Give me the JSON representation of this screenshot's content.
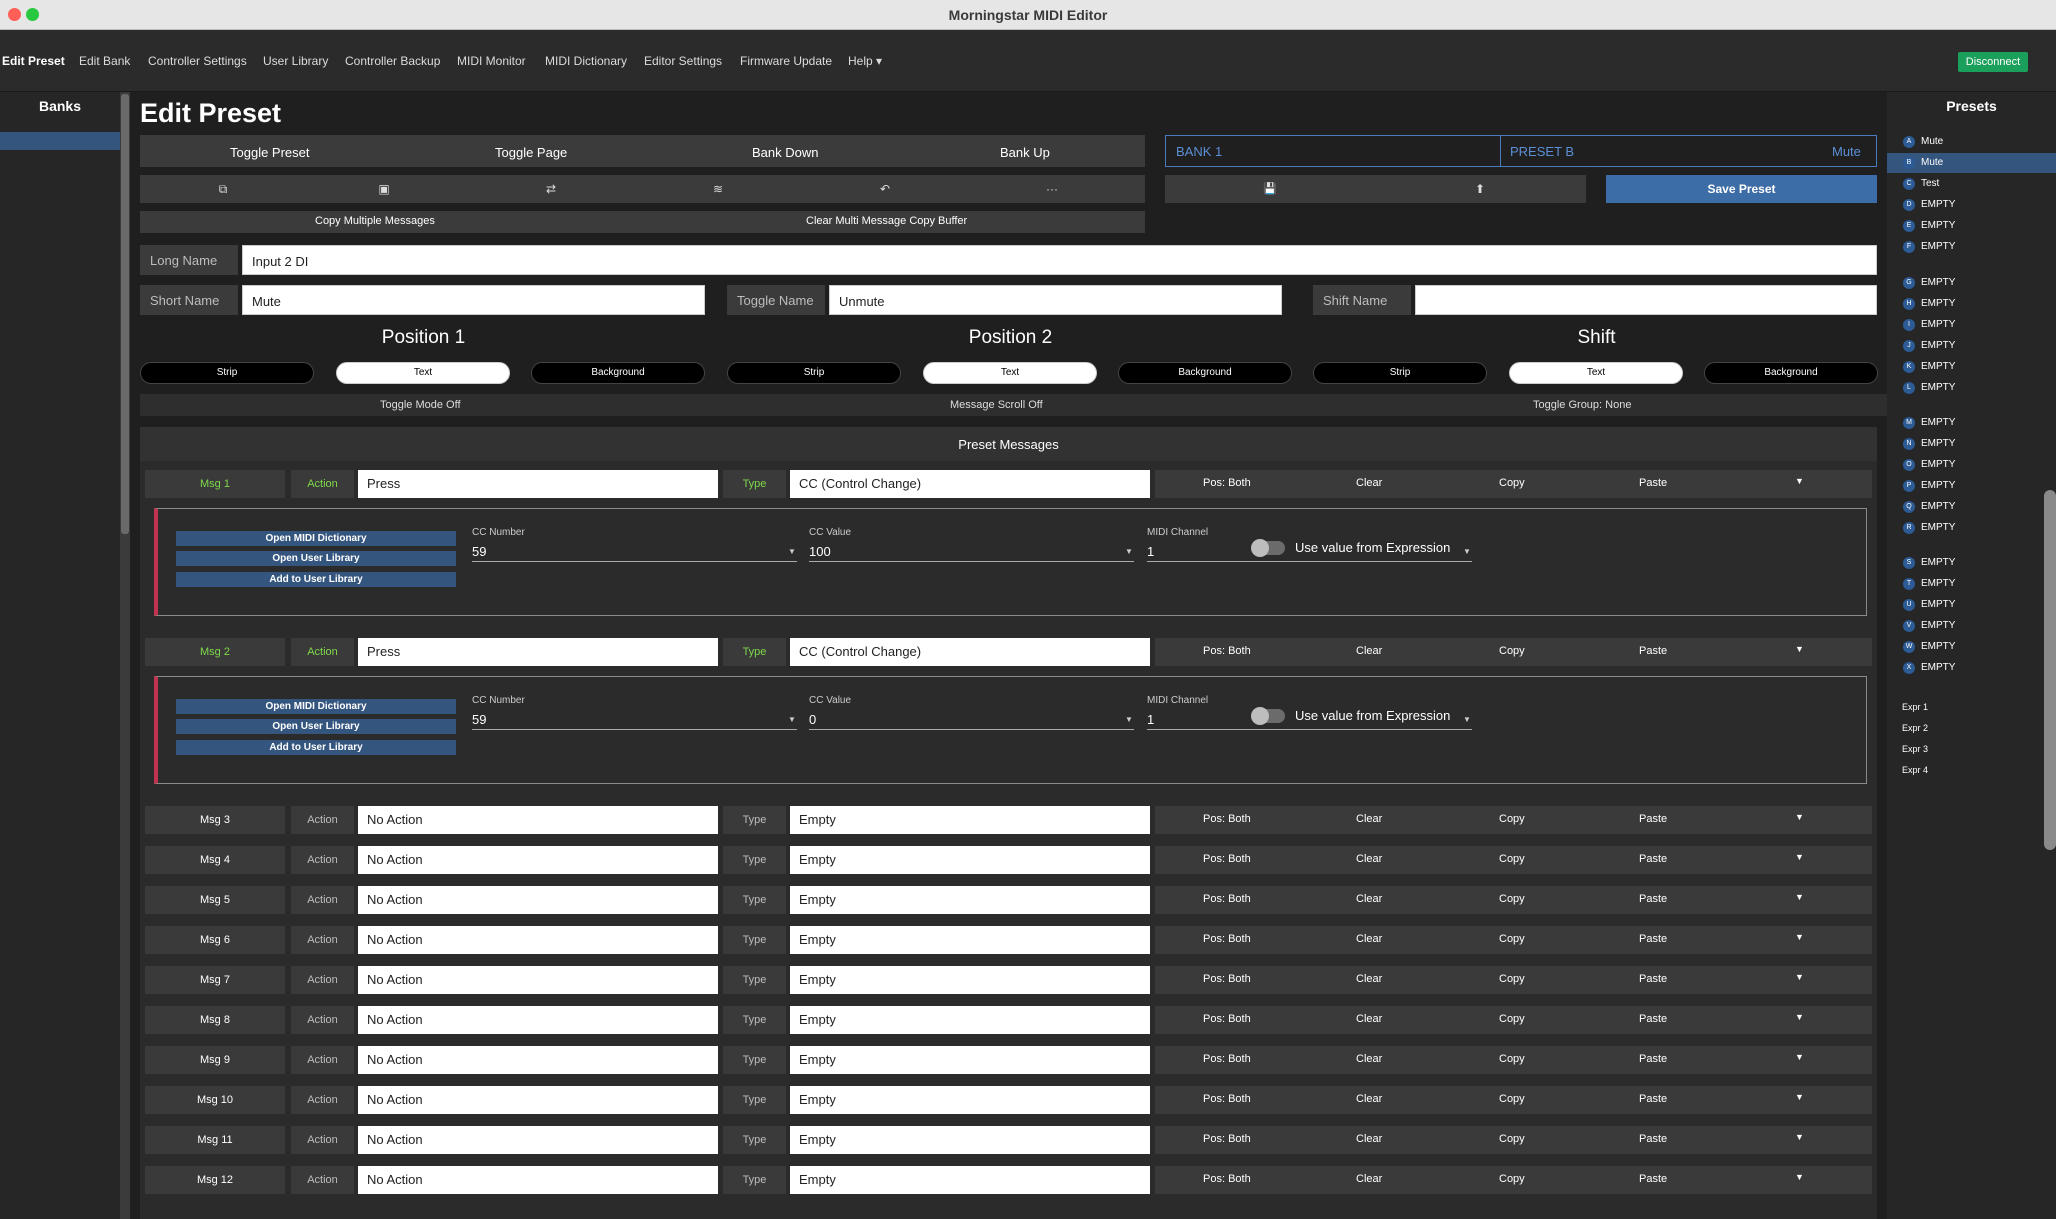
{
  "window": {
    "title": "Morningstar MIDI Editor"
  },
  "menu": {
    "items": [
      "Edit Preset",
      "Edit Bank",
      "Controller Settings",
      "User Library",
      "Controller Backup",
      "MIDI Monitor",
      "MIDI Dictionary",
      "Editor Settings",
      "Firmware Update",
      "Help ▾"
    ],
    "disconnect": "Disconnect"
  },
  "banks": {
    "title": "Banks"
  },
  "presets": {
    "title": "Presets",
    "items": [
      {
        "letter": "A",
        "name": "Mute"
      },
      {
        "letter": "B",
        "name": "Mute"
      },
      {
        "letter": "C",
        "name": "Test"
      },
      {
        "letter": "D",
        "name": "EMPTY"
      },
      {
        "letter": "E",
        "name": "EMPTY"
      },
      {
        "letter": "F",
        "name": "EMPTY"
      },
      {
        "letter": "G",
        "name": "EMPTY"
      },
      {
        "letter": "H",
        "name": "EMPTY"
      },
      {
        "letter": "I",
        "name": "EMPTY"
      },
      {
        "letter": "J",
        "name": "EMPTY"
      },
      {
        "letter": "K",
        "name": "EMPTY"
      },
      {
        "letter": "L",
        "name": "EMPTY"
      },
      {
        "letter": "M",
        "name": "EMPTY"
      },
      {
        "letter": "N",
        "name": "EMPTY"
      },
      {
        "letter": "O",
        "name": "EMPTY"
      },
      {
        "letter": "P",
        "name": "EMPTY"
      },
      {
        "letter": "Q",
        "name": "EMPTY"
      },
      {
        "letter": "R",
        "name": "EMPTY"
      },
      {
        "letter": "S",
        "name": "EMPTY"
      },
      {
        "letter": "T",
        "name": "EMPTY"
      },
      {
        "letter": "U",
        "name": "EMPTY"
      },
      {
        "letter": "V",
        "name": "EMPTY"
      },
      {
        "letter": "W",
        "name": "EMPTY"
      },
      {
        "letter": "X",
        "name": "EMPTY"
      }
    ],
    "expr": [
      "Expr 1",
      "Expr 2",
      "Expr 3",
      "Expr 4"
    ]
  },
  "editor": {
    "title": "Edit Preset",
    "nav": [
      "Toggle Preset",
      "Toggle Page",
      "Bank Down",
      "Bank Up"
    ],
    "icons": [
      "copy-icon",
      "paste-icon",
      "swap-icon",
      "stack-icon",
      "undo-icon",
      "more-icon"
    ],
    "icon_glyphs": [
      "⧉",
      "▣",
      "⇄",
      "≋",
      "↶",
      "···"
    ],
    "bank": "BANK 1",
    "preset": "PRESET B",
    "preset_short": "Mute",
    "save_glyph": "💾",
    "upload_glyph": "⬆",
    "save_preset": "Save Preset",
    "copy_multiple": "Copy Multiple Messages",
    "clear_buffer": "Clear Multi Message Copy Buffer",
    "long_name_label": "Long Name",
    "long_name": "Input 2 DI",
    "short_name_label": "Short Name",
    "short_name": "Mute",
    "toggle_name_label": "Toggle Name",
    "toggle_name": "Unmute",
    "shift_name_label": "Shift Name",
    "shift_name": "",
    "positions": [
      "Position 1",
      "Position 2",
      "Shift"
    ],
    "pills": [
      "Strip",
      "Text",
      "Background"
    ],
    "toggle_mode": "Toggle Mode Off",
    "message_scroll": "Message Scroll Off",
    "toggle_group": "Toggle Group: None",
    "messages_header": "Preset Messages",
    "labels": {
      "action": "Action",
      "type": "Type",
      "pos": "Pos: Both",
      "clear": "Clear",
      "copy": "Copy",
      "paste": "Paste"
    },
    "detail_buttons": [
      "Open MIDI Dictionary",
      "Open User Library",
      "Add to User Library"
    ],
    "field_labels": [
      "CC Number",
      "CC Value",
      "MIDI Channel"
    ],
    "expression_toggle": "Use value from Expression",
    "messages": [
      {
        "label": "Msg 1",
        "action": "Press",
        "type": "CC (Control Change)",
        "active": true,
        "cc_number": "59",
        "cc_value": "100",
        "channel": "1"
      },
      {
        "label": "Msg 2",
        "action": "Press",
        "type": "CC (Control Change)",
        "active": true,
        "cc_number": "59",
        "cc_value": "0",
        "channel": "1"
      },
      {
        "label": "Msg 3",
        "action": "No Action",
        "type": "Empty",
        "active": false
      },
      {
        "label": "Msg 4",
        "action": "No Action",
        "type": "Empty",
        "active": false
      },
      {
        "label": "Msg 5",
        "action": "No Action",
        "type": "Empty",
        "active": false
      },
      {
        "label": "Msg 6",
        "action": "No Action",
        "type": "Empty",
        "active": false
      },
      {
        "label": "Msg 7",
        "action": "No Action",
        "type": "Empty",
        "active": false
      },
      {
        "label": "Msg 8",
        "action": "No Action",
        "type": "Empty",
        "active": false
      },
      {
        "label": "Msg 9",
        "action": "No Action",
        "type": "Empty",
        "active": false
      },
      {
        "label": "Msg 10",
        "action": "No Action",
        "type": "Empty",
        "active": false
      },
      {
        "label": "Msg 11",
        "action": "No Action",
        "type": "Empty",
        "active": false
      },
      {
        "label": "Msg 12",
        "action": "No Action",
        "type": "Empty",
        "active": false
      }
    ]
  },
  "colors": {
    "accent_blue": "#3d6da6",
    "green": "#1aa05a",
    "msg_green": "#7fd94a",
    "red_border": "#c2334f"
  }
}
